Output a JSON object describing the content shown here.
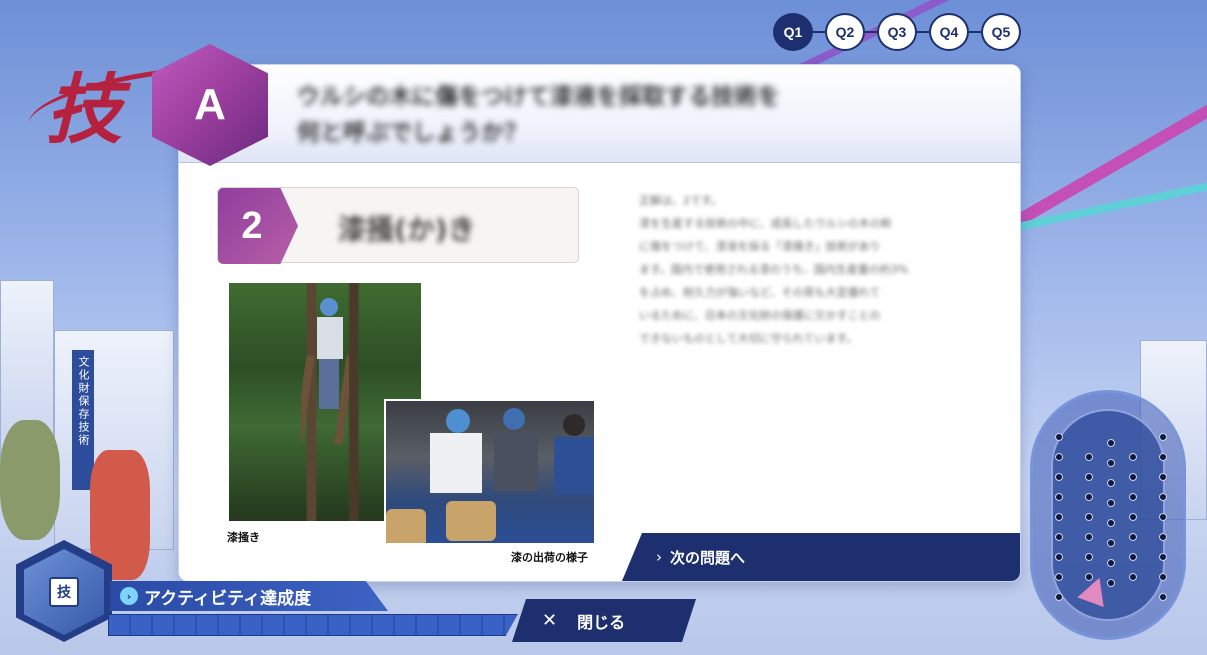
{
  "logo": {
    "kanji": "技"
  },
  "steps": [
    {
      "label": "Q1",
      "active": true
    },
    {
      "label": "Q2",
      "active": false
    },
    {
      "label": "Q3",
      "active": false
    },
    {
      "label": "Q4",
      "active": false
    },
    {
      "label": "Q5",
      "active": false
    }
  ],
  "question": {
    "badge": "A",
    "text_line1": "ウルシの木に傷をつけて漆液を採取する技術を",
    "text_line2": "何と呼ぶでしょうか？"
  },
  "answer": {
    "number": "2",
    "text": "漆掻(か)き"
  },
  "photos": {
    "caption_1": "漆掻き",
    "caption_2": "漆の出荷の様子"
  },
  "explanation": {
    "lines": [
      "正解は、2です。",
      "漆を生産する技術の中に、成長したウルシの木の幹",
      "に傷をつけて、漆液を採る「漆掻き」技術があり",
      "ます。国内で使用される漆のうち、国内生産量の約3%",
      "を占め、耐久力が強いなど、その質も大変優れて",
      "いるために、日本の文化財の保護に欠かすことの",
      "できないものとして大切に守られています。"
    ]
  },
  "buttons": {
    "next_label": "次の問題へ",
    "close_label": "閉じる"
  },
  "activity": {
    "label": "アクティビティ達成度",
    "icon_kanji": "技",
    "progress_fraction": 0.0
  },
  "background": {
    "banner_text": "文化財保存技術"
  },
  "colors": {
    "navy": "#1d2f6e",
    "accent_purple": "#9b3e9e",
    "brand_red": "#b5213e",
    "activity_blue": "#3d63c4"
  }
}
